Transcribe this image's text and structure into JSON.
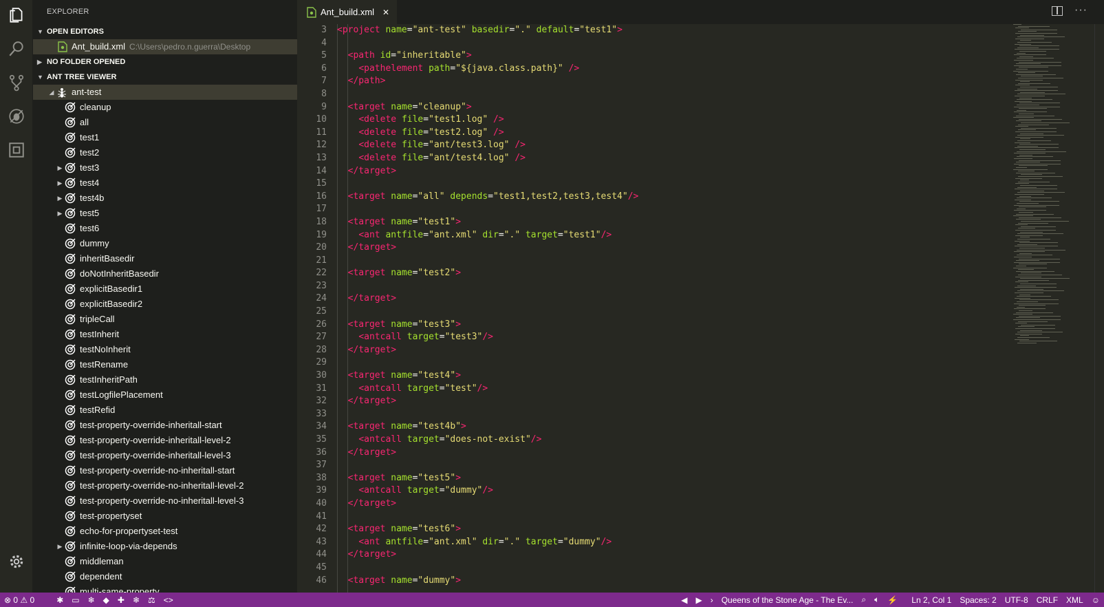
{
  "sidebar": {
    "title": "EXPLORER",
    "open_editors": {
      "label": "OPEN EDITORS",
      "file": "Ant_build.xml",
      "path": "C:\\Users\\pedro.n.guerra\\Desktop"
    },
    "no_folder": {
      "label": "NO FOLDER OPENED"
    },
    "ant_tree": {
      "label": "ANT TREE VIEWER",
      "root": "ant-test",
      "targets": [
        {
          "label": "cleanup",
          "expandable": false
        },
        {
          "label": "all",
          "expandable": false
        },
        {
          "label": "test1",
          "expandable": false
        },
        {
          "label": "test2",
          "expandable": false
        },
        {
          "label": "test3",
          "expandable": true
        },
        {
          "label": "test4",
          "expandable": true
        },
        {
          "label": "test4b",
          "expandable": true
        },
        {
          "label": "test5",
          "expandable": true
        },
        {
          "label": "test6",
          "expandable": false
        },
        {
          "label": "dummy",
          "expandable": false
        },
        {
          "label": "inheritBasedir",
          "expandable": false
        },
        {
          "label": "doNotInheritBasedir",
          "expandable": false
        },
        {
          "label": "explicitBasedir1",
          "expandable": false
        },
        {
          "label": "explicitBasedir2",
          "expandable": false
        },
        {
          "label": "tripleCall",
          "expandable": false
        },
        {
          "label": "testInherit",
          "expandable": false
        },
        {
          "label": "testNoInherit",
          "expandable": false
        },
        {
          "label": "testRename",
          "expandable": false
        },
        {
          "label": "testInheritPath",
          "expandable": false
        },
        {
          "label": "testLogfilePlacement",
          "expandable": false
        },
        {
          "label": "testRefid",
          "expandable": false
        },
        {
          "label": "test-property-override-inheritall-start",
          "expandable": false
        },
        {
          "label": "test-property-override-inheritall-level-2",
          "expandable": false
        },
        {
          "label": "test-property-override-inheritall-level-3",
          "expandable": false
        },
        {
          "label": "test-property-override-no-inheritall-start",
          "expandable": false
        },
        {
          "label": "test-property-override-no-inheritall-level-2",
          "expandable": false
        },
        {
          "label": "test-property-override-no-inheritall-level-3",
          "expandable": false
        },
        {
          "label": "test-propertyset",
          "expandable": false
        },
        {
          "label": "echo-for-propertyset-test",
          "expandable": false
        },
        {
          "label": "infinite-loop-via-depends",
          "expandable": true
        },
        {
          "label": "middleman",
          "expandable": false
        },
        {
          "label": "dependent",
          "expandable": false
        },
        {
          "label": "multi-same-property",
          "expandable": false
        }
      ]
    }
  },
  "tab": {
    "label": "Ant_build.xml",
    "close": "✕"
  },
  "editor": {
    "line_numbers": [
      "3",
      "4",
      "5",
      "6",
      "7",
      "8",
      "9",
      "10",
      "11",
      "12",
      "13",
      "14",
      "15",
      "16",
      "17",
      "18",
      "19",
      "20",
      "21",
      "22",
      "23",
      "24",
      "25",
      "26",
      "27",
      "28",
      "29",
      "30",
      "31",
      "32",
      "33",
      "34",
      "35",
      "36",
      "37",
      "38",
      "39",
      "40",
      "41",
      "42",
      "43",
      "44",
      "45",
      "46"
    ],
    "lines": [
      [
        {
          "c": "t",
          "v": "<project"
        },
        {
          "c": "p",
          "v": " "
        },
        {
          "c": "a",
          "v": "name"
        },
        {
          "c": "p",
          "v": "="
        },
        {
          "c": "s",
          "v": "\"ant-test\""
        },
        {
          "c": "p",
          "v": " "
        },
        {
          "c": "a",
          "v": "basedir"
        },
        {
          "c": "p",
          "v": "="
        },
        {
          "c": "s",
          "v": "\".\""
        },
        {
          "c": "p",
          "v": " "
        },
        {
          "c": "a",
          "v": "default"
        },
        {
          "c": "p",
          "v": "="
        },
        {
          "c": "s",
          "v": "\"test1\""
        },
        {
          "c": "t",
          "v": ">"
        }
      ],
      [],
      [
        {
          "c": "p",
          "v": "  "
        },
        {
          "c": "t",
          "v": "<path"
        },
        {
          "c": "p",
          "v": " "
        },
        {
          "c": "a",
          "v": "id"
        },
        {
          "c": "p",
          "v": "="
        },
        {
          "c": "s",
          "v": "\"inheritable\""
        },
        {
          "c": "t",
          "v": ">"
        }
      ],
      [
        {
          "c": "p",
          "v": "    "
        },
        {
          "c": "t",
          "v": "<pathelement"
        },
        {
          "c": "p",
          "v": " "
        },
        {
          "c": "a",
          "v": "path"
        },
        {
          "c": "p",
          "v": "="
        },
        {
          "c": "s",
          "v": "\"${java.class.path}\""
        },
        {
          "c": "p",
          "v": " "
        },
        {
          "c": "t",
          "v": "/>"
        }
      ],
      [
        {
          "c": "p",
          "v": "  "
        },
        {
          "c": "t",
          "v": "</path>"
        }
      ],
      [],
      [
        {
          "c": "p",
          "v": "  "
        },
        {
          "c": "t",
          "v": "<target"
        },
        {
          "c": "p",
          "v": " "
        },
        {
          "c": "a",
          "v": "name"
        },
        {
          "c": "p",
          "v": "="
        },
        {
          "c": "s",
          "v": "\"cleanup\""
        },
        {
          "c": "t",
          "v": ">"
        }
      ],
      [
        {
          "c": "p",
          "v": "    "
        },
        {
          "c": "t",
          "v": "<delete"
        },
        {
          "c": "p",
          "v": " "
        },
        {
          "c": "a",
          "v": "file"
        },
        {
          "c": "p",
          "v": "="
        },
        {
          "c": "s",
          "v": "\"test1.log\""
        },
        {
          "c": "p",
          "v": " "
        },
        {
          "c": "t",
          "v": "/>"
        }
      ],
      [
        {
          "c": "p",
          "v": "    "
        },
        {
          "c": "t",
          "v": "<delete"
        },
        {
          "c": "p",
          "v": " "
        },
        {
          "c": "a",
          "v": "file"
        },
        {
          "c": "p",
          "v": "="
        },
        {
          "c": "s",
          "v": "\"test2.log\""
        },
        {
          "c": "p",
          "v": " "
        },
        {
          "c": "t",
          "v": "/>"
        }
      ],
      [
        {
          "c": "p",
          "v": "    "
        },
        {
          "c": "t",
          "v": "<delete"
        },
        {
          "c": "p",
          "v": " "
        },
        {
          "c": "a",
          "v": "file"
        },
        {
          "c": "p",
          "v": "="
        },
        {
          "c": "s",
          "v": "\"ant/test3.log\""
        },
        {
          "c": "p",
          "v": " "
        },
        {
          "c": "t",
          "v": "/>"
        }
      ],
      [
        {
          "c": "p",
          "v": "    "
        },
        {
          "c": "t",
          "v": "<delete"
        },
        {
          "c": "p",
          "v": " "
        },
        {
          "c": "a",
          "v": "file"
        },
        {
          "c": "p",
          "v": "="
        },
        {
          "c": "s",
          "v": "\"ant/test4.log\""
        },
        {
          "c": "p",
          "v": " "
        },
        {
          "c": "t",
          "v": "/>"
        }
      ],
      [
        {
          "c": "p",
          "v": "  "
        },
        {
          "c": "t",
          "v": "</target>"
        }
      ],
      [],
      [
        {
          "c": "p",
          "v": "  "
        },
        {
          "c": "t",
          "v": "<target"
        },
        {
          "c": "p",
          "v": " "
        },
        {
          "c": "a",
          "v": "name"
        },
        {
          "c": "p",
          "v": "="
        },
        {
          "c": "s",
          "v": "\"all\""
        },
        {
          "c": "p",
          "v": " "
        },
        {
          "c": "a",
          "v": "depends"
        },
        {
          "c": "p",
          "v": "="
        },
        {
          "c": "s",
          "v": "\"test1,test2,test3,test4\""
        },
        {
          "c": "t",
          "v": "/>"
        }
      ],
      [],
      [
        {
          "c": "p",
          "v": "  "
        },
        {
          "c": "t",
          "v": "<target"
        },
        {
          "c": "p",
          "v": " "
        },
        {
          "c": "a",
          "v": "name"
        },
        {
          "c": "p",
          "v": "="
        },
        {
          "c": "s",
          "v": "\"test1\""
        },
        {
          "c": "t",
          "v": ">"
        }
      ],
      [
        {
          "c": "p",
          "v": "    "
        },
        {
          "c": "t",
          "v": "<ant"
        },
        {
          "c": "p",
          "v": " "
        },
        {
          "c": "a",
          "v": "antfile"
        },
        {
          "c": "p",
          "v": "="
        },
        {
          "c": "s",
          "v": "\"ant.xml\""
        },
        {
          "c": "p",
          "v": " "
        },
        {
          "c": "a",
          "v": "dir"
        },
        {
          "c": "p",
          "v": "="
        },
        {
          "c": "s",
          "v": "\".\""
        },
        {
          "c": "p",
          "v": " "
        },
        {
          "c": "a",
          "v": "target"
        },
        {
          "c": "p",
          "v": "="
        },
        {
          "c": "s",
          "v": "\"test1\""
        },
        {
          "c": "t",
          "v": "/>"
        }
      ],
      [
        {
          "c": "p",
          "v": "  "
        },
        {
          "c": "t",
          "v": "</target>"
        }
      ],
      [],
      [
        {
          "c": "p",
          "v": "  "
        },
        {
          "c": "t",
          "v": "<target"
        },
        {
          "c": "p",
          "v": " "
        },
        {
          "c": "a",
          "v": "name"
        },
        {
          "c": "p",
          "v": "="
        },
        {
          "c": "s",
          "v": "\"test2\""
        },
        {
          "c": "t",
          "v": ">"
        }
      ],
      [],
      [
        {
          "c": "p",
          "v": "  "
        },
        {
          "c": "t",
          "v": "</target>"
        }
      ],
      [],
      [
        {
          "c": "p",
          "v": "  "
        },
        {
          "c": "t",
          "v": "<target"
        },
        {
          "c": "p",
          "v": " "
        },
        {
          "c": "a",
          "v": "name"
        },
        {
          "c": "p",
          "v": "="
        },
        {
          "c": "s",
          "v": "\"test3\""
        },
        {
          "c": "t",
          "v": ">"
        }
      ],
      [
        {
          "c": "p",
          "v": "    "
        },
        {
          "c": "t",
          "v": "<antcall"
        },
        {
          "c": "p",
          "v": " "
        },
        {
          "c": "a",
          "v": "target"
        },
        {
          "c": "p",
          "v": "="
        },
        {
          "c": "s",
          "v": "\"test3\""
        },
        {
          "c": "t",
          "v": "/>"
        }
      ],
      [
        {
          "c": "p",
          "v": "  "
        },
        {
          "c": "t",
          "v": "</target>"
        }
      ],
      [],
      [
        {
          "c": "p",
          "v": "  "
        },
        {
          "c": "t",
          "v": "<target"
        },
        {
          "c": "p",
          "v": " "
        },
        {
          "c": "a",
          "v": "name"
        },
        {
          "c": "p",
          "v": "="
        },
        {
          "c": "s",
          "v": "\"test4\""
        },
        {
          "c": "t",
          "v": ">"
        }
      ],
      [
        {
          "c": "p",
          "v": "    "
        },
        {
          "c": "t",
          "v": "<antcall"
        },
        {
          "c": "p",
          "v": " "
        },
        {
          "c": "a",
          "v": "target"
        },
        {
          "c": "p",
          "v": "="
        },
        {
          "c": "s",
          "v": "\"test\""
        },
        {
          "c": "t",
          "v": "/>"
        }
      ],
      [
        {
          "c": "p",
          "v": "  "
        },
        {
          "c": "t",
          "v": "</target>"
        }
      ],
      [],
      [
        {
          "c": "p",
          "v": "  "
        },
        {
          "c": "t",
          "v": "<target"
        },
        {
          "c": "p",
          "v": " "
        },
        {
          "c": "a",
          "v": "name"
        },
        {
          "c": "p",
          "v": "="
        },
        {
          "c": "s",
          "v": "\"test4b\""
        },
        {
          "c": "t",
          "v": ">"
        }
      ],
      [
        {
          "c": "p",
          "v": "    "
        },
        {
          "c": "t",
          "v": "<antcall"
        },
        {
          "c": "p",
          "v": " "
        },
        {
          "c": "a",
          "v": "target"
        },
        {
          "c": "p",
          "v": "="
        },
        {
          "c": "s",
          "v": "\"does-not-exist\""
        },
        {
          "c": "t",
          "v": "/>"
        }
      ],
      [
        {
          "c": "p",
          "v": "  "
        },
        {
          "c": "t",
          "v": "</target>"
        }
      ],
      [],
      [
        {
          "c": "p",
          "v": "  "
        },
        {
          "c": "t",
          "v": "<target"
        },
        {
          "c": "p",
          "v": " "
        },
        {
          "c": "a",
          "v": "name"
        },
        {
          "c": "p",
          "v": "="
        },
        {
          "c": "s",
          "v": "\"test5\""
        },
        {
          "c": "t",
          "v": ">"
        }
      ],
      [
        {
          "c": "p",
          "v": "    "
        },
        {
          "c": "t",
          "v": "<antcall"
        },
        {
          "c": "p",
          "v": " "
        },
        {
          "c": "a",
          "v": "target"
        },
        {
          "c": "p",
          "v": "="
        },
        {
          "c": "s",
          "v": "\"dummy\""
        },
        {
          "c": "t",
          "v": "/>"
        }
      ],
      [
        {
          "c": "p",
          "v": "  "
        },
        {
          "c": "t",
          "v": "</target>"
        }
      ],
      [],
      [
        {
          "c": "p",
          "v": "  "
        },
        {
          "c": "t",
          "v": "<target"
        },
        {
          "c": "p",
          "v": " "
        },
        {
          "c": "a",
          "v": "name"
        },
        {
          "c": "p",
          "v": "="
        },
        {
          "c": "s",
          "v": "\"test6\""
        },
        {
          "c": "t",
          "v": ">"
        }
      ],
      [
        {
          "c": "p",
          "v": "    "
        },
        {
          "c": "t",
          "v": "<ant"
        },
        {
          "c": "p",
          "v": " "
        },
        {
          "c": "a",
          "v": "antfile"
        },
        {
          "c": "p",
          "v": "="
        },
        {
          "c": "s",
          "v": "\"ant.xml\""
        },
        {
          "c": "p",
          "v": " "
        },
        {
          "c": "a",
          "v": "dir"
        },
        {
          "c": "p",
          "v": "="
        },
        {
          "c": "s",
          "v": "\".\""
        },
        {
          "c": "p",
          "v": " "
        },
        {
          "c": "a",
          "v": "target"
        },
        {
          "c": "p",
          "v": "="
        },
        {
          "c": "s",
          "v": "\"dummy\""
        },
        {
          "c": "t",
          "v": "/>"
        }
      ],
      [
        {
          "c": "p",
          "v": "  "
        },
        {
          "c": "t",
          "v": "</target>"
        }
      ],
      [],
      [
        {
          "c": "p",
          "v": "  "
        },
        {
          "c": "t",
          "v": "<target"
        },
        {
          "c": "p",
          "v": " "
        },
        {
          "c": "a",
          "v": "name"
        },
        {
          "c": "p",
          "v": "="
        },
        {
          "c": "s",
          "v": "\"dummy\""
        },
        {
          "c": "t",
          "v": ">"
        }
      ]
    ]
  },
  "status": {
    "errors": "0",
    "warnings": "0",
    "song": "Queens of the Stone Age - The Ev...",
    "position": "Ln 2, Col 1",
    "spaces": "Spaces: 2",
    "encoding": "UTF-8",
    "eol": "CRLF",
    "language": "XML"
  },
  "colors": {
    "status_bar": "#7d2a8c",
    "tag": "#f92672",
    "attr": "#a6e22e",
    "string": "#e6db74"
  }
}
